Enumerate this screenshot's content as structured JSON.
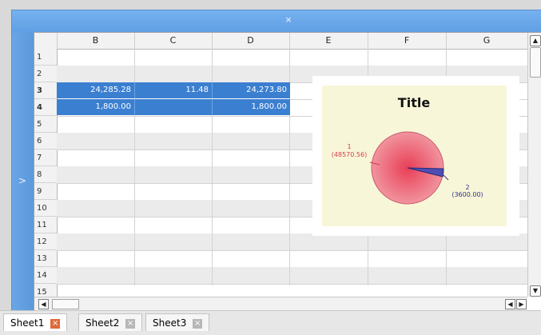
{
  "window": {
    "close_glyph": "×",
    "left_toggle_glyph": ">"
  },
  "columns": [
    "B",
    "C",
    "D",
    "E",
    "F",
    "G"
  ],
  "rows": [
    "1",
    "2",
    "3",
    "4",
    "5",
    "6",
    "7",
    "8",
    "9",
    "10",
    "11",
    "12",
    "13",
    "14",
    "15"
  ],
  "cells": {
    "row3": {
      "B": "24,285.28",
      "C": "11.48",
      "D": "24,273.80"
    },
    "row4": {
      "B": "1,800.00",
      "C": "",
      "D": "1,800.00"
    }
  },
  "chart_data": {
    "type": "pie",
    "title": "Title",
    "slices": [
      {
        "label": "1",
        "value_label": "(48570.56)",
        "value": 48570.56,
        "color": "#e14b63"
      },
      {
        "label": "2",
        "value_label": "(3600.00)",
        "value": 3600.0,
        "color": "#3f3f9f"
      }
    ]
  },
  "tabs": [
    {
      "label": "Sheet1",
      "active": true,
      "close_color": "#e06a3a"
    },
    {
      "label": "Sheet2",
      "active": false,
      "close_color": "#b8b8b8"
    },
    {
      "label": "Sheet3",
      "active": false,
      "close_color": "#b8b8b8"
    }
  ],
  "scroll": {
    "up": "▲",
    "down": "▼",
    "left": "◀",
    "right": "▶"
  }
}
